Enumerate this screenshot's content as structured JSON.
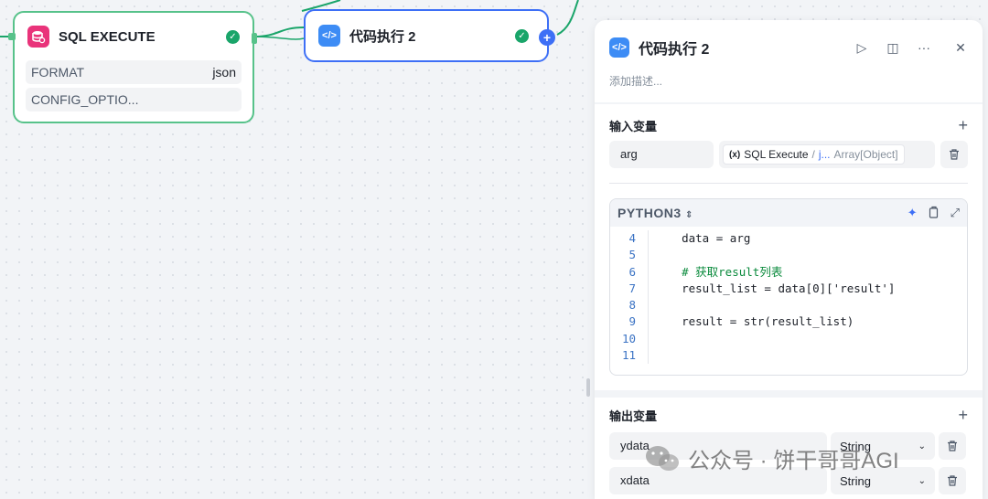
{
  "canvas": {
    "sql_node": {
      "title": "SQL EXECUTE",
      "fields": [
        {
          "key": "FORMAT",
          "value": "json"
        },
        {
          "key": "CONFIG_OPTIO...",
          "value": ""
        }
      ]
    },
    "code_node": {
      "title": "代码执行 2"
    }
  },
  "panel": {
    "title": "代码执行 2",
    "description_placeholder": "添加描述...",
    "input_section_title": "输入变量",
    "inputs": [
      {
        "name": "arg",
        "source_node": "SQL Execute",
        "separator": "/",
        "source_var": "j...",
        "type": "Array[Object]"
      }
    ],
    "editor": {
      "language": "PYTHON3",
      "lines": [
        {
          "no": "4",
          "text": "data = arg"
        },
        {
          "no": "5",
          "text": ""
        },
        {
          "no": "6",
          "text": "# 获取result列表"
        },
        {
          "no": "7",
          "text": "result_list = data[0]['result']"
        },
        {
          "no": "8",
          "text": ""
        },
        {
          "no": "9",
          "text": "result = str(result_list)"
        },
        {
          "no": "10",
          "text": ""
        },
        {
          "no": "11",
          "text": ""
        }
      ]
    },
    "output_section_title": "输出变量",
    "outputs": [
      {
        "name": "ydata",
        "type": "String"
      },
      {
        "name": "xdata",
        "type": "String"
      }
    ]
  },
  "watermark": {
    "text": "公众号 · 饼干哥哥AGI"
  },
  "icons": {
    "run": "play-icon",
    "split": "split-view-icon",
    "more": "more-icon",
    "close": "close-icon",
    "delete": "trash-icon",
    "ai": "sparkle-icon",
    "copy": "copy-icon",
    "expand": "expand-icon"
  },
  "colors": {
    "accent_blue": "#3d6ff6",
    "success_green": "#1aa56a",
    "db_pink": "#e9337a"
  }
}
